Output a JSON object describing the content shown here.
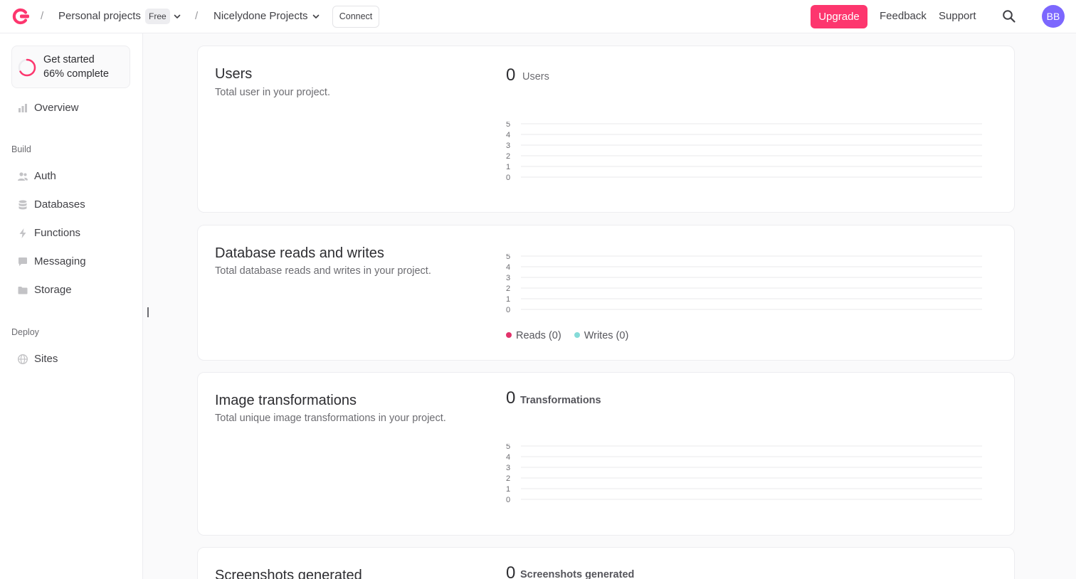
{
  "header": {
    "breadcrumb_org": "Personal projects",
    "org_plan_badge": "Free",
    "breadcrumb_project": "Nicelydone Projects",
    "connect_label": "Connect",
    "upgrade_label": "Upgrade",
    "feedback_label": "Feedback",
    "support_label": "Support",
    "avatar_initials": "BB",
    "separator": "/"
  },
  "sidebar": {
    "get_started": {
      "title": "Get started",
      "subtitle": "66% complete",
      "progress": 0.66
    },
    "overview_label": "Overview",
    "build_heading": "Build",
    "build_items": [
      {
        "label": "Auth",
        "icon": "users-icon"
      },
      {
        "label": "Databases",
        "icon": "database-icon"
      },
      {
        "label": "Functions",
        "icon": "lightning-icon"
      },
      {
        "label": "Messaging",
        "icon": "chat-icon"
      },
      {
        "label": "Storage",
        "icon": "folder-icon"
      }
    ],
    "deploy_heading": "Deploy",
    "deploy_items": [
      {
        "label": "Sites",
        "icon": "globe-icon"
      }
    ]
  },
  "cards": {
    "users": {
      "title": "Users",
      "description": "Total user in your project.",
      "count": "0",
      "count_label": "Users"
    },
    "database": {
      "title": "Database reads and writes",
      "description": "Total database reads and writes in your project.",
      "legend_reads": "Reads (0)",
      "legend_writes": "Writes (0)"
    },
    "images": {
      "title": "Image transformations",
      "description": "Total unique image transformations in your project.",
      "count": "0",
      "count_label": "Transformations"
    },
    "screenshots": {
      "title": "Screenshots generated",
      "count": "0",
      "count_label": "Screenshots generated"
    }
  },
  "colors": {
    "brand": "#fd366e",
    "reads": "#e2336b",
    "writes": "#85dbd8",
    "avatar": "#7c67fe"
  },
  "chart_data": [
    {
      "type": "line",
      "title": "Users",
      "y_ticks": [
        "5",
        "4",
        "3",
        "2",
        "1",
        "0"
      ],
      "ylim": [
        0,
        5
      ],
      "series": [
        {
          "name": "Users",
          "values": []
        }
      ]
    },
    {
      "type": "bar",
      "title": "Database reads and writes",
      "y_ticks": [
        "5",
        "4",
        "3",
        "2",
        "1",
        "0"
      ],
      "ylim": [
        0,
        5
      ],
      "series": [
        {
          "name": "Reads (0)",
          "values": []
        },
        {
          "name": "Writes (0)",
          "values": []
        }
      ]
    },
    {
      "type": "line",
      "title": "Image transformations",
      "y_ticks": [
        "5",
        "4",
        "3",
        "2",
        "1",
        "0"
      ],
      "ylim": [
        0,
        5
      ],
      "series": [
        {
          "name": "Transformations",
          "values": []
        }
      ]
    }
  ]
}
